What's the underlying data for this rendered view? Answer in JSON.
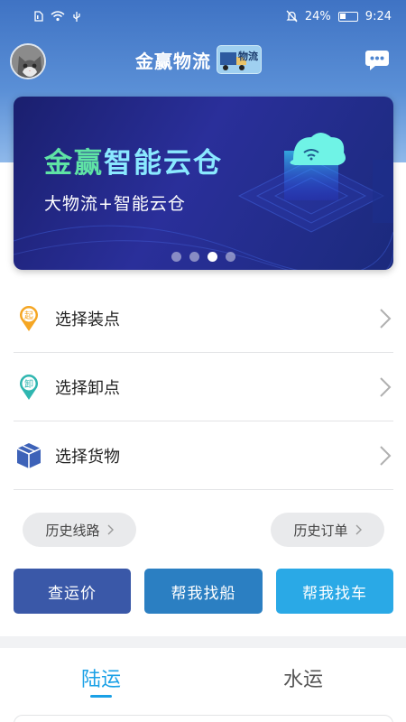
{
  "status_bar": {
    "battery_percent": "24%",
    "time": "9:24"
  },
  "header": {
    "app_title": "金赢物流",
    "logo_text": "物流"
  },
  "banner": {
    "title_highlight": "金赢",
    "title_rest": "智能云仓",
    "subtitle": "大物流+智能云仓",
    "page_count": 4,
    "active_page": 3
  },
  "menu": {
    "items": [
      {
        "label": "选择装点",
        "badge": "起",
        "badge_color": "#f5a623"
      },
      {
        "label": "选择卸点",
        "badge": "卸",
        "badge_color": "#2fb6b0"
      },
      {
        "label": "选择货物",
        "icon": "box-icon",
        "icon_color": "#3d62b8"
      }
    ]
  },
  "history": {
    "routes_label": "历史线路",
    "orders_label": "历史订单"
  },
  "actions": {
    "check_price": "查运价",
    "find_ship": "帮我找船",
    "find_truck": "帮我找车",
    "colors": [
      "#3a58a8",
      "#2b7fc2",
      "#2aa9e6"
    ]
  },
  "tabs": {
    "land": "陆运",
    "water": "水运",
    "active": "land",
    "active_color": "#1aa0e6"
  }
}
